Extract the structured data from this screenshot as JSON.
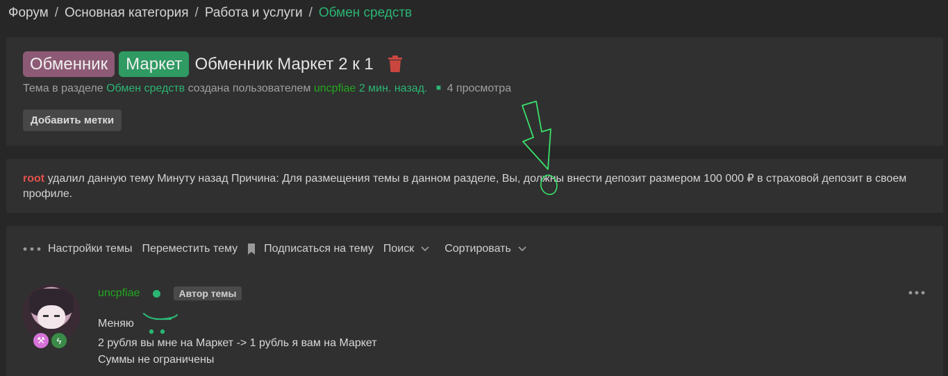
{
  "breadcrumb": {
    "items": [
      "Форум",
      "Основная категория",
      "Работа и услуги"
    ],
    "current": "Обмен средств",
    "separator": "/"
  },
  "thread": {
    "prefixes": [
      "Обменник",
      "Маркет"
    ],
    "title": "Обменник Маркет 2 к 1",
    "meta": {
      "prefix_text": "Тема в разделе",
      "section": "Обмен средств",
      "created_by_text": "создана пользователем",
      "author": "uncpfiae",
      "time": "2 мин. назад.",
      "views": "4 просмотра"
    },
    "add_tags_label": "Добавить метки"
  },
  "notice": {
    "user": "root",
    "text": "удалил данную тему Минуту назад Причина: Для размещения темы в данном разделе, Вы, должны внести депозит размером 100 000 ₽ в страховой депозит в своем профиле."
  },
  "toolbar": {
    "settings": "Настройки темы",
    "move": "Переместить тему",
    "subscribe": "Подписаться на тему",
    "search": "Поиск",
    "sort": "Сортировать"
  },
  "post": {
    "username": "uncpfiae",
    "author_badge": "Автор темы",
    "lines": [
      "Меняю",
      "2 рубля вы мне на Маркет -> 1 рубль я вам на Маркет",
      "Суммы не ограничены"
    ],
    "badges": [
      "⚒",
      "ϟ"
    ]
  },
  "colors": {
    "background": "#272727",
    "panel": "#303030",
    "accent_green": "#2bb573",
    "user_green": "#22a81f",
    "prefix_exchanger": "#8d5a75",
    "prefix_market": "#2f9a62",
    "root_red": "#e2504b",
    "annotation_green": "#39e26a"
  },
  "icons": {
    "trash": "trash-icon",
    "more": "more-dots-icon",
    "bookmark": "bookmark-icon",
    "chevron": "chevron-down-icon",
    "online": "online-dot-icon"
  }
}
